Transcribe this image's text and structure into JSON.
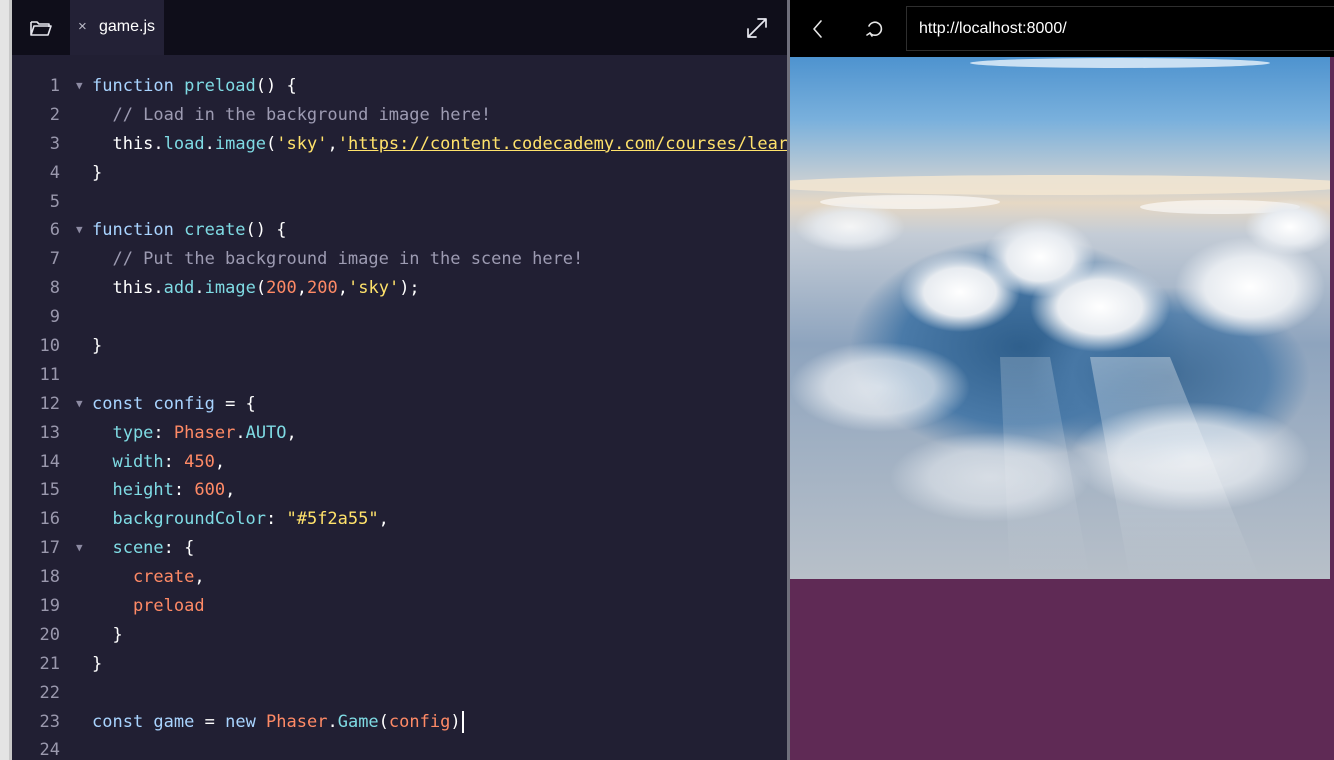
{
  "editor": {
    "tab_close": "×",
    "tab_filename": "game.js",
    "folder_icon": "folder-open-icon",
    "expand_icon": "expand-icon",
    "lines": [
      {
        "n": "1",
        "fold": true,
        "tokens": [
          {
            "c": "kw",
            "t": "function "
          },
          {
            "c": "pr",
            "t": "preload"
          },
          {
            "c": "pl",
            "t": "() {"
          }
        ]
      },
      {
        "n": "2",
        "fold": false,
        "tokens": [
          {
            "c": "cm",
            "t": "  // Load in the background image here!"
          }
        ]
      },
      {
        "n": "3",
        "fold": false,
        "tokens": [
          {
            "c": "pl",
            "t": "  this."
          },
          {
            "c": "pr",
            "t": "load"
          },
          {
            "c": "pl",
            "t": "."
          },
          {
            "c": "pr",
            "t": "image"
          },
          {
            "c": "pl",
            "t": "("
          },
          {
            "c": "st",
            "t": "'sky'"
          },
          {
            "c": "pl",
            "t": ","
          },
          {
            "c": "st",
            "t": "'"
          },
          {
            "c": "url",
            "t": "https://content.codecademy.com/courses/learn-phaser/sky.jpg"
          },
          {
            "c": "st",
            "t": "'"
          },
          {
            "c": "pl",
            "t": ");"
          }
        ]
      },
      {
        "n": "4",
        "fold": false,
        "tokens": [
          {
            "c": "pl",
            "t": "}"
          }
        ]
      },
      {
        "n": "5",
        "fold": false,
        "tokens": []
      },
      {
        "n": "6",
        "fold": true,
        "tokens": [
          {
            "c": "kw",
            "t": "function "
          },
          {
            "c": "pr",
            "t": "create"
          },
          {
            "c": "pl",
            "t": "() {"
          }
        ]
      },
      {
        "n": "7",
        "fold": false,
        "tokens": [
          {
            "c": "cm",
            "t": "  // Put the background image in the scene here!"
          }
        ]
      },
      {
        "n": "8",
        "fold": false,
        "tokens": [
          {
            "c": "pl",
            "t": "  this."
          },
          {
            "c": "pr",
            "t": "add"
          },
          {
            "c": "pl",
            "t": "."
          },
          {
            "c": "pr",
            "t": "image"
          },
          {
            "c": "pl",
            "t": "("
          },
          {
            "c": "nm",
            "t": "200"
          },
          {
            "c": "pl",
            "t": ","
          },
          {
            "c": "nm",
            "t": "200"
          },
          {
            "c": "pl",
            "t": ","
          },
          {
            "c": "st",
            "t": "'sky'"
          },
          {
            "c": "pl",
            "t": ");"
          }
        ]
      },
      {
        "n": "9",
        "fold": false,
        "tokens": []
      },
      {
        "n": "10",
        "fold": false,
        "tokens": [
          {
            "c": "pl",
            "t": "}"
          }
        ]
      },
      {
        "n": "11",
        "fold": false,
        "tokens": []
      },
      {
        "n": "12",
        "fold": true,
        "tokens": [
          {
            "c": "kw",
            "t": "const "
          },
          {
            "c": "kw",
            "t": "config"
          },
          {
            "c": "pl",
            "t": " = {"
          }
        ]
      },
      {
        "n": "13",
        "fold": false,
        "tokens": [
          {
            "c": "pr",
            "t": "  type"
          },
          {
            "c": "pl",
            "t": ": "
          },
          {
            "c": "vr",
            "t": "Phaser"
          },
          {
            "c": "pl",
            "t": "."
          },
          {
            "c": "pr",
            "t": "AUTO"
          },
          {
            "c": "pl",
            "t": ","
          }
        ]
      },
      {
        "n": "14",
        "fold": false,
        "tokens": [
          {
            "c": "pr",
            "t": "  width"
          },
          {
            "c": "pl",
            "t": ": "
          },
          {
            "c": "nm",
            "t": "450"
          },
          {
            "c": "pl",
            "t": ","
          }
        ]
      },
      {
        "n": "15",
        "fold": false,
        "tokens": [
          {
            "c": "pr",
            "t": "  height"
          },
          {
            "c": "pl",
            "t": ": "
          },
          {
            "c": "nm",
            "t": "600"
          },
          {
            "c": "pl",
            "t": ","
          }
        ]
      },
      {
        "n": "16",
        "fold": false,
        "tokens": [
          {
            "c": "pr",
            "t": "  backgroundColor"
          },
          {
            "c": "pl",
            "t": ": "
          },
          {
            "c": "st",
            "t": "\"#5f2a55\""
          },
          {
            "c": "pl",
            "t": ","
          }
        ]
      },
      {
        "n": "17",
        "fold": true,
        "tokens": [
          {
            "c": "pr",
            "t": "  scene"
          },
          {
            "c": "pl",
            "t": ": {"
          }
        ]
      },
      {
        "n": "18",
        "fold": false,
        "tokens": [
          {
            "c": "vr",
            "t": "    create"
          },
          {
            "c": "pl",
            "t": ","
          }
        ]
      },
      {
        "n": "19",
        "fold": false,
        "tokens": [
          {
            "c": "vr",
            "t": "    preload"
          }
        ]
      },
      {
        "n": "20",
        "fold": false,
        "tokens": [
          {
            "c": "pl",
            "t": "  }"
          }
        ]
      },
      {
        "n": "21",
        "fold": false,
        "tokens": [
          {
            "c": "pl",
            "t": "}"
          }
        ]
      },
      {
        "n": "22",
        "fold": false,
        "tokens": []
      },
      {
        "n": "23",
        "fold": false,
        "cursor": true,
        "tokens": [
          {
            "c": "kw",
            "t": "const "
          },
          {
            "c": "kw",
            "t": "game"
          },
          {
            "c": "pl",
            "t": " = "
          },
          {
            "c": "kw",
            "t": "new "
          },
          {
            "c": "vr",
            "t": "Phaser"
          },
          {
            "c": "pl",
            "t": "."
          },
          {
            "c": "pr",
            "t": "Game"
          },
          {
            "c": "pl",
            "t": "("
          },
          {
            "c": "vr",
            "t": "config"
          },
          {
            "c": "pl",
            "t": ")"
          }
        ]
      },
      {
        "n": "24",
        "fold": false,
        "tokens": []
      }
    ]
  },
  "browser": {
    "back_icon": "chevron-left-icon",
    "reload_icon": "reload-icon",
    "url": "http://localhost:8000/",
    "canvas_background": "#5f2a55",
    "image_key": "sky"
  },
  "colors": {
    "editor_bg": "#211f33",
    "header_bg": "#0f0e1a",
    "keyword": "#a9d4ff",
    "property": "#7fdbe4",
    "string": "#ffe26b",
    "number": "#ff8a66",
    "comment": "#9d9bb2"
  }
}
